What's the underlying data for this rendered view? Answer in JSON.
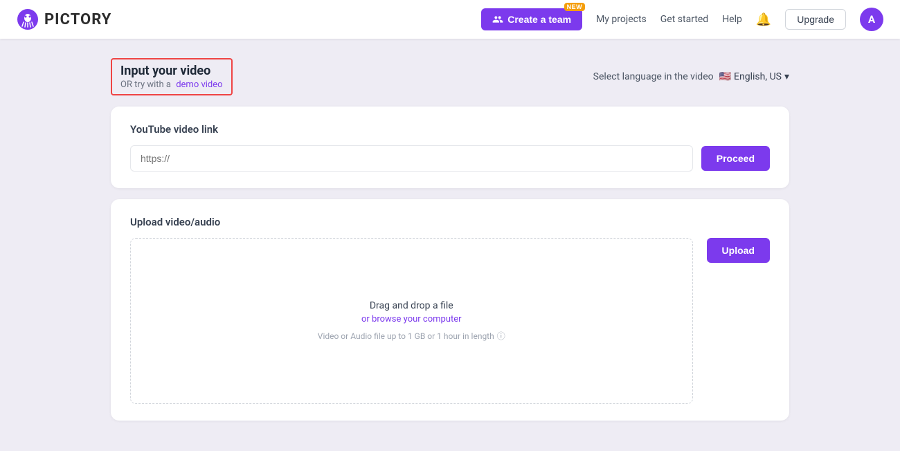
{
  "header": {
    "logo_text": "PICTORY",
    "create_team_label": "Create a team",
    "new_badge": "NEW",
    "nav": {
      "my_projects": "My projects",
      "get_started": "Get started",
      "help": "Help"
    },
    "upgrade_label": "Upgrade",
    "avatar_letter": "A"
  },
  "page": {
    "input_title": "Input your video",
    "or_try_prefix": "OR try with a",
    "demo_link_label": "demo video",
    "language_label": "Select language in the video",
    "language_value": "English, US"
  },
  "youtube_section": {
    "title": "YouTube video link",
    "input_placeholder": "https://",
    "proceed_label": "Proceed"
  },
  "upload_section": {
    "title": "Upload video/audio",
    "drop_main": "Drag and drop a file",
    "drop_sub": "or browse your computer",
    "drop_hint": "Video or Audio file up to 1 GB or 1 hour in length",
    "upload_label": "Upload"
  }
}
